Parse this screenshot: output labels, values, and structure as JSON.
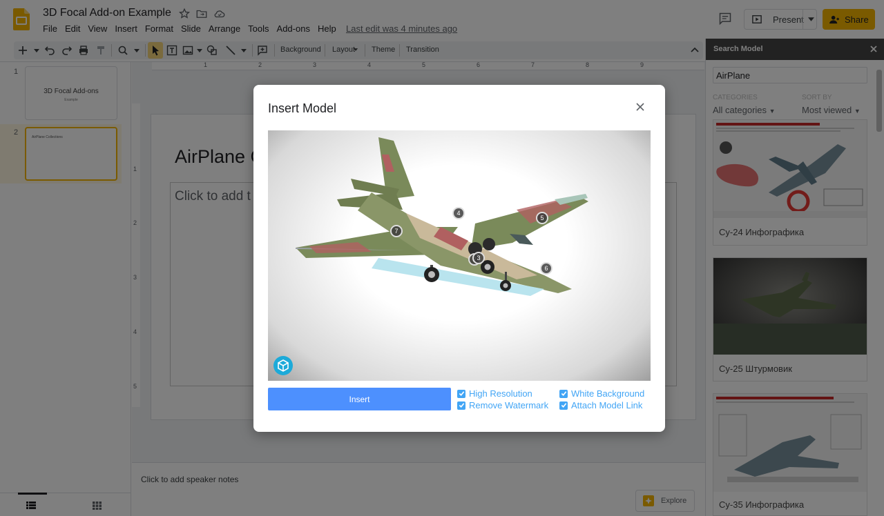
{
  "app": {
    "doc_title": "3D Focal Add-on Example",
    "menu": [
      "File",
      "Edit",
      "View",
      "Insert",
      "Format",
      "Slide",
      "Arrange",
      "Tools",
      "Add-ons",
      "Help"
    ],
    "last_edit": "Last edit was 4 minutes ago",
    "present_label": "Present",
    "share_label": "Share"
  },
  "toolbar": {
    "background_label": "Background",
    "layout_label": "Layout",
    "theme_label": "Theme",
    "transition_label": "Transition"
  },
  "filmstrip": {
    "slides": [
      {
        "number": "1",
        "title": "3D Focal Add-ons",
        "subtitle": "Example"
      },
      {
        "number": "2",
        "title": "AirPlane Collections"
      }
    ]
  },
  "editor": {
    "slide_title": "AirPlane C",
    "slide_body_placeholder": "Click to add t",
    "notes_placeholder": "Click to add speaker notes",
    "explore_label": "Explore",
    "ruler_numbers": [
      "1",
      "2",
      "3",
      "4",
      "5",
      "6",
      "7",
      "8",
      "9"
    ],
    "vruler_numbers": [
      "1",
      "2",
      "3",
      "4",
      "5"
    ]
  },
  "sidebar": {
    "title": "Search Model",
    "search_value": "AirPlane",
    "categories_label": "CATEGORIES",
    "categories_value": "All categories",
    "sort_label": "SORT BY",
    "sort_value": "Most viewed",
    "results": [
      {
        "title": "Су-24 Инфографика"
      },
      {
        "title": "Су-25 Штурмовик"
      },
      {
        "title": "Су-35 Инфографика"
      }
    ]
  },
  "dialog": {
    "title": "Insert Model",
    "insert_label": "Insert",
    "options": {
      "high_resolution": {
        "label": "High Resolution",
        "checked": true
      },
      "remove_watermark": {
        "label": "Remove Watermark",
        "checked": true
      },
      "white_background": {
        "label": "White Background",
        "checked": true
      },
      "attach_model_link": {
        "label": "Attach Model Link",
        "checked": true
      }
    },
    "hotspots": [
      "2",
      "3",
      "4",
      "5",
      "6",
      "7"
    ]
  },
  "colors": {
    "accent": "#4d90fe",
    "share": "#f4b400",
    "checkbox": "#42a5f5"
  }
}
